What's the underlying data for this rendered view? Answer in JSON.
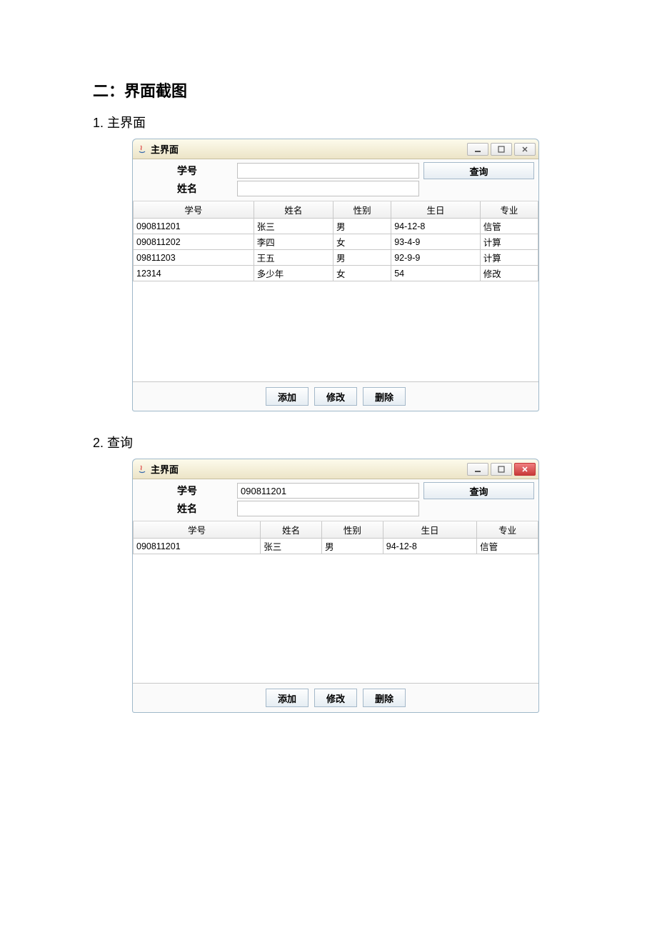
{
  "doc": {
    "heading": "二：界面截图",
    "sub1": "1. 主界面",
    "sub2": "2. 查询"
  },
  "win1": {
    "title": "主界面",
    "labels": {
      "id": "学号",
      "name": "姓名"
    },
    "inputs": {
      "id": "",
      "name": ""
    },
    "searchBtn": "查询",
    "columns": [
      "学号",
      "姓名",
      "性别",
      "生日",
      "专业"
    ],
    "rows": [
      {
        "c1": "090811201",
        "c2": "张三",
        "c3": "男",
        "c4": "94-12-8",
        "c5": "信管"
      },
      {
        "c1": "090811202",
        "c2": "李四",
        "c3": "女",
        "c4": "93-4-9",
        "c5": "计算"
      },
      {
        "c1": "09811203",
        "c2": "王五",
        "c3": "男",
        "c4": "92-9-9",
        "c5": "计算"
      },
      {
        "c1": "12314",
        "c2": "多少年",
        "c3": "女",
        "c4": "54",
        "c5": "修改"
      }
    ],
    "buttons": {
      "add": "添加",
      "edit": "修改",
      "delete": "删除"
    }
  },
  "win2": {
    "title": "主界面",
    "labels": {
      "id": "学号",
      "name": "姓名"
    },
    "inputs": {
      "id": "090811201",
      "name": ""
    },
    "searchBtn": "查询",
    "columns": [
      "学号",
      "姓名",
      "性别",
      "生日",
      "专业"
    ],
    "rows": [
      {
        "c1": "090811201",
        "c2": "张三",
        "c3": "男",
        "c4": "94-12-8",
        "c5": "信管"
      }
    ],
    "buttons": {
      "add": "添加",
      "edit": "修改",
      "delete": "删除"
    }
  }
}
